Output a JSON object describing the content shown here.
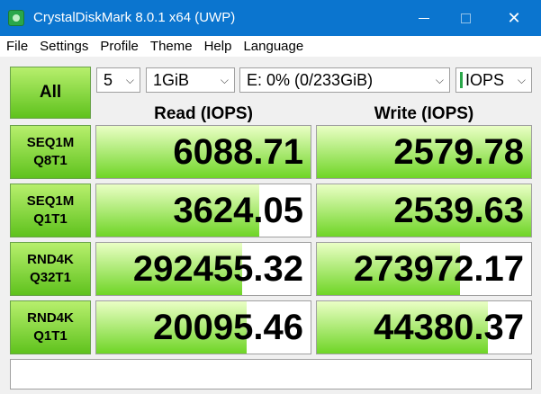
{
  "window": {
    "title": "CrystalDiskMark 8.0.1 x64 (UWP)",
    "icon": "crystaldiskmark-icon",
    "minimize_glyph": "",
    "close_glyph": "✕"
  },
  "menu": [
    "File",
    "Settings",
    "Profile",
    "Theme",
    "Help",
    "Language"
  ],
  "toolbar": {
    "all_label": "All",
    "count": "5",
    "size": "1GiB",
    "drive": "E: 0% (0/233GiB)",
    "unit": "IOPS",
    "chevron": "⌵"
  },
  "headers": {
    "read": "Read (IOPS)",
    "write": "Write (IOPS)"
  },
  "tests": [
    {
      "line1": "SEQ1M",
      "line2": "Q8T1",
      "read": "6088.71",
      "write": "2579.78",
      "read_fill": 1.0,
      "write_fill": 1.0
    },
    {
      "line1": "SEQ1M",
      "line2": "Q1T1",
      "read": "3624.05",
      "write": "2539.63",
      "read_fill": 0.76,
      "write_fill": 1.0
    },
    {
      "line1": "RND4K",
      "line2": "Q32T1",
      "read": "292455.32",
      "write": "273972.17",
      "read_fill": 0.68,
      "write_fill": 0.67
    },
    {
      "line1": "RND4K",
      "line2": "Q1T1",
      "read": "20095.46",
      "write": "44380.37",
      "read_fill": 0.7,
      "write_fill": 0.8
    }
  ],
  "comment": "",
  "colors": {
    "titlebar": "#0b75cf",
    "button_green": "#5fc21d",
    "bar_green": "#6fd526"
  }
}
